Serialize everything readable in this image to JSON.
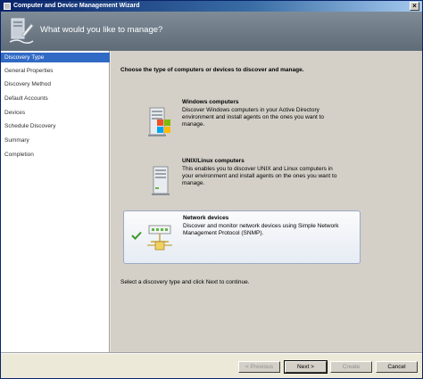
{
  "window": {
    "title": "Computer and Device Management Wizard"
  },
  "banner": {
    "heading": "What would you like to manage?"
  },
  "steps": [
    {
      "label": "Discovery Type",
      "active": true
    },
    {
      "label": "General Properties"
    },
    {
      "label": "Discovery Method"
    },
    {
      "label": "Default Accounts"
    },
    {
      "label": "Devices"
    },
    {
      "label": "Schedule Discovery"
    },
    {
      "label": "Summary"
    },
    {
      "label": "Completion"
    }
  ],
  "content": {
    "instruction": "Choose the type of computers or devices to discover and manage.",
    "footer": "Select a discovery type and click Next to continue."
  },
  "options": [
    {
      "title": "Windows computers",
      "description": "Discover Windows computers in your Active Directory environment and install agents on the ones you want to manage.",
      "icon": "windows-computer-icon"
    },
    {
      "title": "UNIX/Linux computers",
      "description": "This enables you to discover UNIX and Linux computers in your environment and install agents on the ones you want to manage.",
      "icon": "unix-computer-icon"
    },
    {
      "title": "Network devices",
      "description": "Discover and monitor network devices using Simple Network Management Protocol (SNMP).",
      "icon": "network-device-icon",
      "selected": true
    }
  ],
  "buttons": {
    "previous": "< Previous",
    "next": "Next >",
    "create": "Create",
    "cancel": "Cancel"
  },
  "colors": {
    "selection": "#316ac5",
    "banner": "#6f7c88"
  }
}
